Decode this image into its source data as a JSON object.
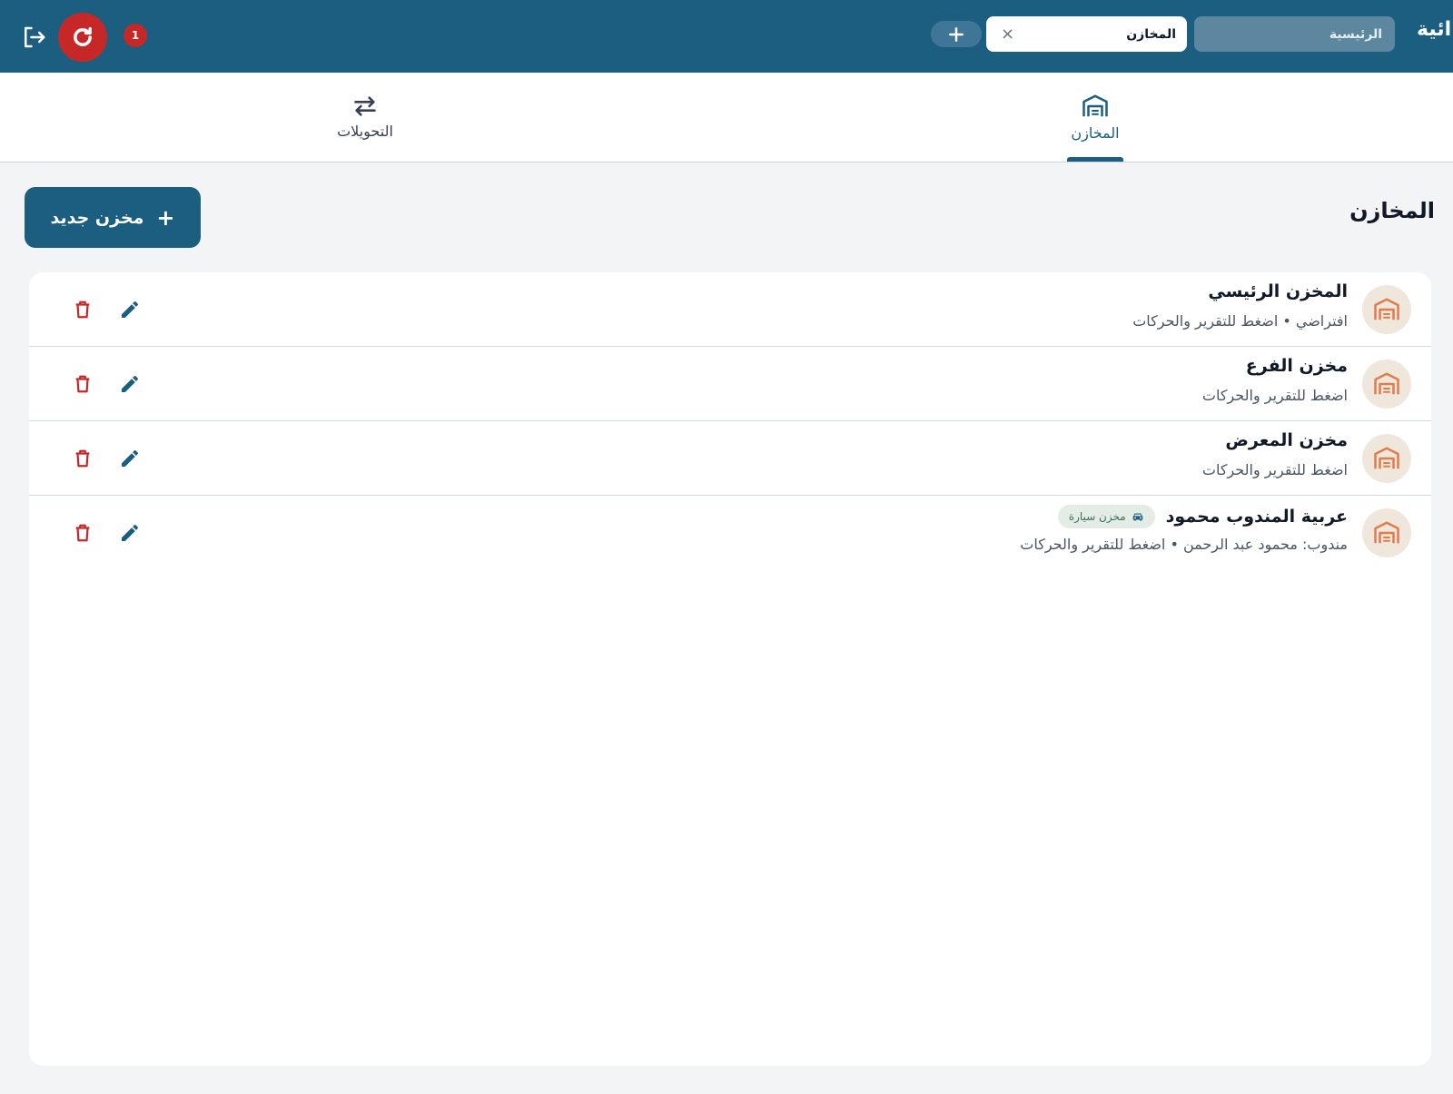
{
  "app": {
    "title": "ائية"
  },
  "topbar": {
    "notification_count": "1",
    "tabs": [
      {
        "label": "الرئيسية"
      },
      {
        "label": "المخازن",
        "close": "×"
      }
    ]
  },
  "section_tabs": [
    {
      "label": "المخازن",
      "icon": "warehouse-icon",
      "active": true
    },
    {
      "label": "التحويلات",
      "icon": "swap-arrows-icon",
      "active": false
    }
  ],
  "page": {
    "title": "المخازن",
    "new_button": {
      "label": "مخزن جديد",
      "icon": "+"
    }
  },
  "warehouses": [
    {
      "title": "المخزن الرئيسي",
      "subtitle": "افتراضي • اضغط للتقرير والحركات",
      "badge": ""
    },
    {
      "title": "مخزن الفرع",
      "subtitle": "اضغط للتقرير والحركات",
      "badge": ""
    },
    {
      "title": "مخزن المعرض",
      "subtitle": "اضغط للتقرير والحركات",
      "badge": ""
    },
    {
      "title": "عربية المندوب محمود",
      "subtitle": "مندوب: محمود عبد الرحمن • اضغط للتقرير والحركات",
      "badge": "مخزن سيارة"
    }
  ],
  "colors": {
    "primary": "#1b5e80",
    "danger": "#c62828",
    "warehouse_icon": "#e07b4c",
    "avatar_bg": "#efe7dc",
    "badge_bg": "#e3ede6"
  }
}
